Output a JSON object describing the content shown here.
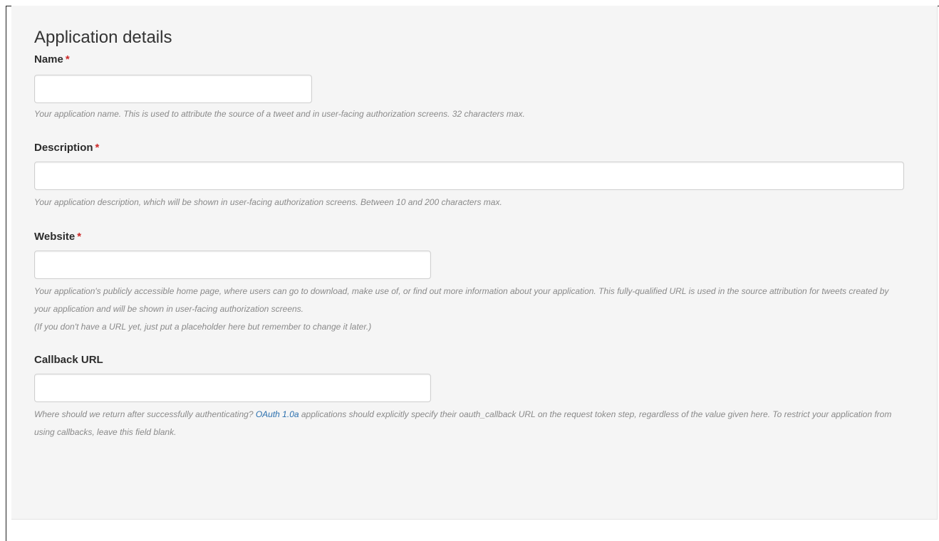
{
  "section_title": "Application details",
  "required_marker": "*",
  "fields": {
    "name": {
      "label": "Name",
      "value": "",
      "help": "Your application name. This is used to attribute the source of a tweet and in user-facing authorization screens. 32 characters max."
    },
    "description": {
      "label": "Description",
      "value": "",
      "help": "Your application description, which will be shown in user-facing authorization screens. Between 10 and 200 characters max."
    },
    "website": {
      "label": "Website",
      "value": "",
      "help": "Your application's publicly accessible home page, where users can go to download, make use of, or find out more information about your application. This fully-qualified URL is used in the source attribution for tweets created by your application and will be shown in user-facing authorization screens.",
      "help_note": "(If you don't have a URL yet, just put a placeholder here but remember to change it later.)"
    },
    "callback_url": {
      "label": "Callback URL",
      "value": "",
      "help_before_link": "Where should we return after successfully authenticating? ",
      "help_link": "OAuth 1.0a",
      "help_after_link": " applications should explicitly specify their oauth_callback URL on the request token step, regardless of the value given here. To restrict your application from using callbacks, leave this field blank."
    }
  },
  "colors": {
    "panel_background": "#f5f5f5",
    "required_marker": "#cc2a2a",
    "link": "#2a6fae",
    "help_text": "#8a8a8a"
  }
}
